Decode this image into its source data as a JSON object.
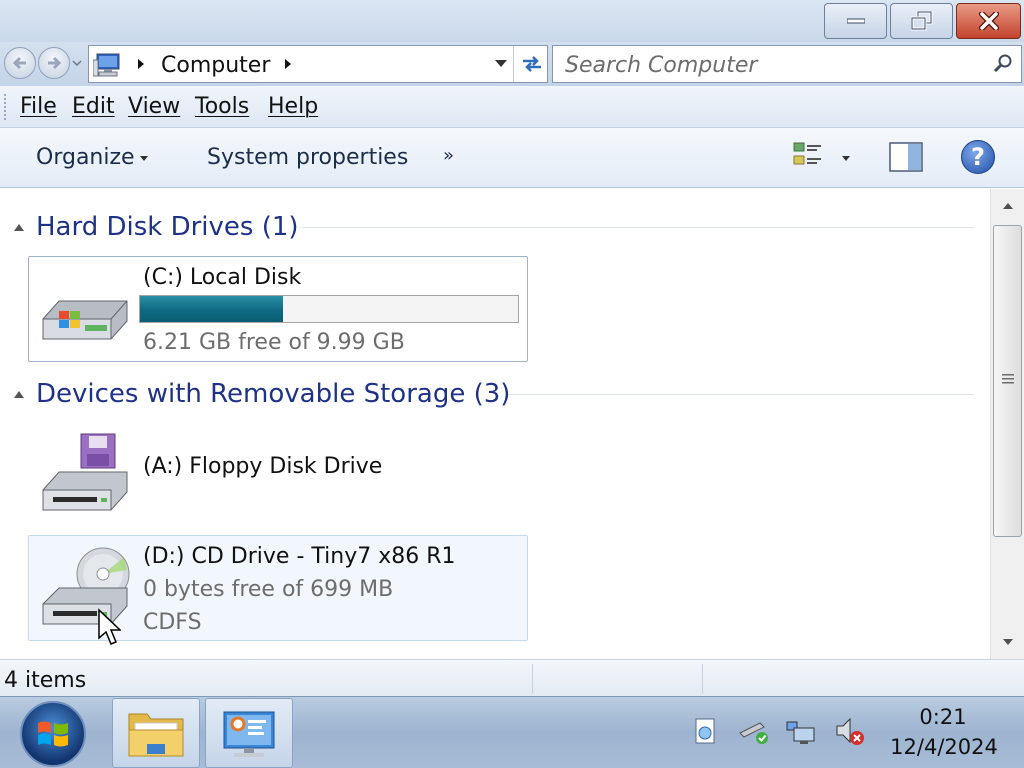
{
  "window": {
    "caption_buttons": {
      "minimize": "minimize",
      "maximize": "restore",
      "close": "close"
    }
  },
  "address": {
    "crumb": "Computer",
    "search_placeholder": "Search Computer"
  },
  "menu": {
    "file": "File",
    "edit": "Edit",
    "view": "View",
    "tools": "Tools",
    "help": "Help"
  },
  "commands": {
    "organize": "Organize",
    "system_properties": "System properties",
    "more": "»"
  },
  "groups": {
    "hard_disks": {
      "title": "Hard Disk Drives (1)",
      "drives": [
        {
          "name": "(C:) Local Disk",
          "free_text": "6.21 GB free of 9.99 GB",
          "used_fraction": 0.378,
          "icon": "hard-disk-windows-icon"
        }
      ]
    },
    "removable": {
      "title": "Devices with Removable Storage (3)",
      "drives": [
        {
          "name": "(A:) Floppy Disk Drive",
          "icon": "floppy-drive-icon"
        },
        {
          "name": "(D:) CD Drive - Tiny7 x86 R1",
          "free_text": "0 bytes free of 699 MB",
          "filesystem": "CDFS",
          "icon": "cd-drive-icon"
        }
      ]
    }
  },
  "status": {
    "items": "4 items"
  },
  "taskbar": {
    "buttons": [
      "windows-explorer-icon",
      "control-panel-icon"
    ],
    "tray_icons": [
      "action-center-icon",
      "safely-remove-hardware-icon",
      "network-icon",
      "volume-muted-icon"
    ],
    "clock_time": "0:21",
    "clock_date": "12/4/2024"
  },
  "colors": {
    "group_title": "#1e3287",
    "capacity_fill": "#0e6a82",
    "selection_border": "#9fb3c9"
  }
}
